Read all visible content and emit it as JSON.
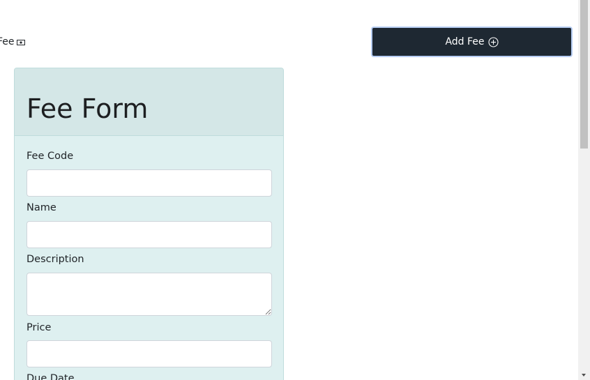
{
  "header": {
    "title": "Fee",
    "title_icon": "money-icon"
  },
  "toolbar": {
    "add_fee_label": "Add Fee",
    "add_fee_icon": "plus-circle-icon",
    "button_color": "#1e2832"
  },
  "form": {
    "title": "Fee Form",
    "fields": [
      {
        "label": "Fee Code",
        "value": "",
        "placeholder": ""
      },
      {
        "label": "Name",
        "value": "",
        "placeholder": ""
      },
      {
        "label": "Description",
        "value": "",
        "placeholder": ""
      },
      {
        "label": "Price",
        "value": "",
        "placeholder": ""
      },
      {
        "label": "Due Date",
        "value": "",
        "placeholder": ""
      }
    ],
    "card_color": "#def0f0"
  }
}
